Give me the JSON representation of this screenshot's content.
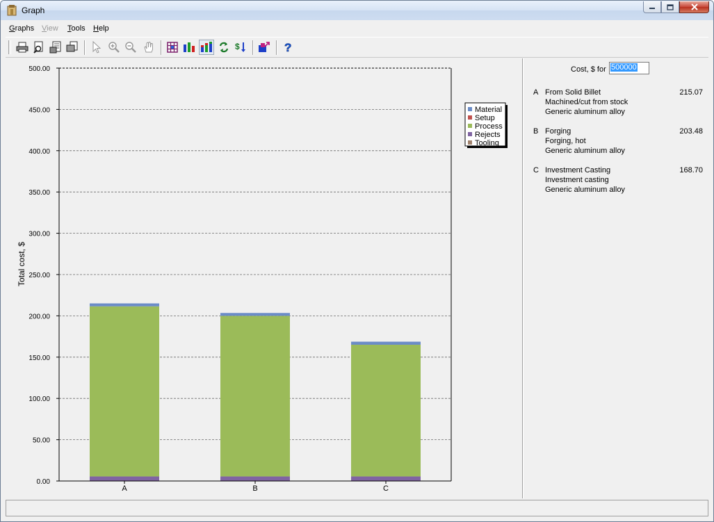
{
  "window": {
    "title": "Graph"
  },
  "menu": [
    {
      "label": "Graphs",
      "underline": "G",
      "rest": "raphs",
      "disabled": false
    },
    {
      "label": "View",
      "underline": "V",
      "rest": "iew",
      "disabled": true
    },
    {
      "label": "Tools",
      "underline": "T",
      "rest": "ools",
      "disabled": false
    },
    {
      "label": "Help",
      "underline": "H",
      "rest": "elp",
      "disabled": false
    }
  ],
  "toolbar": {
    "buttons": [
      "print-icon",
      "print-preview-icon",
      "page-setup-icon",
      "copy-icon",
      "select-pointer-icon",
      "zoom-in-icon",
      "zoom-out-icon",
      "pan-hand-icon",
      "grid-icon",
      "bar-chart-icon",
      "stacked-bar-chart-icon",
      "refresh-icon",
      "sort-icon",
      "export-icon",
      "help-icon"
    ]
  },
  "cost": {
    "label": "Cost, $ for",
    "value": "500000"
  },
  "entries": [
    {
      "letter": "A",
      "name": "From Solid Billet",
      "value": "215.07",
      "process": "Machined/cut from stock",
      "material": "Generic aluminum alloy"
    },
    {
      "letter": "B",
      "name": "Forging",
      "value": "203.48",
      "process": "Forging, hot",
      "material": "Generic aluminum alloy"
    },
    {
      "letter": "C",
      "name": "Investment Casting",
      "value": "168.70",
      "process": "Investment casting",
      "material": "Generic aluminum alloy"
    }
  ],
  "chart_data": {
    "type": "bar",
    "stacked": true,
    "categories": [
      "A",
      "B",
      "C"
    ],
    "ylabel": "Total cost, $",
    "ylim": [
      0,
      500
    ],
    "yticks": [
      "0.00",
      "50.00",
      "100.00",
      "150.00",
      "200.00",
      "250.00",
      "300.00",
      "350.00",
      "400.00",
      "450.00",
      "500.00"
    ],
    "grid": true,
    "legend_position": "top-right",
    "series": [
      {
        "name": "Material",
        "color": "#6b8cc7",
        "values": [
          0,
          0,
          0
        ]
      },
      {
        "name": "Setup",
        "color": "#c0504d",
        "values": [
          0,
          0,
          0
        ]
      },
      {
        "name": "Process",
        "color": "#9bbb59",
        "values": [
          0,
          0,
          0
        ]
      },
      {
        "name": "Rejects",
        "color": "#8064a2",
        "values": [
          0,
          0,
          0
        ]
      },
      {
        "name": "Tooling",
        "color": "#a0826d",
        "values": [
          0,
          0,
          0
        ]
      }
    ],
    "stack_order": [
      {
        "series": "Rejects",
        "color": "#8064a2",
        "values": [
          5.5,
          5.5,
          5.5
        ]
      },
      {
        "series": "Process",
        "color": "#9bbb59",
        "values": [
          206.0,
          194.5,
          159.5
        ]
      },
      {
        "series": "Material",
        "color": "#6b8cc7",
        "values": [
          3.57,
          3.48,
          3.7
        ]
      }
    ]
  }
}
